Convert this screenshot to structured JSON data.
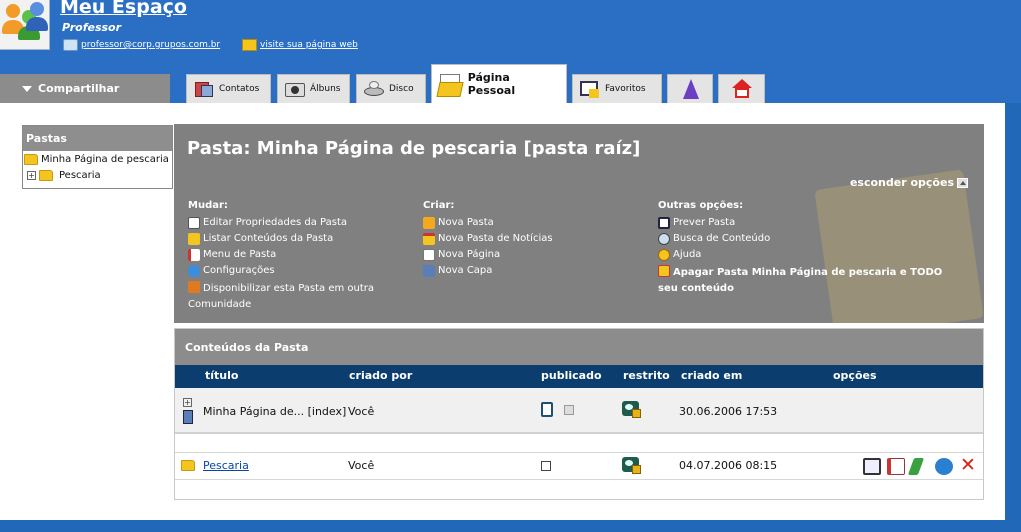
{
  "header": {
    "title": "Meu Espaço",
    "role": "Professor",
    "email": "professor@corp.grupos.com.br",
    "visit_link": "visite sua página web"
  },
  "tabs": {
    "share": "Compartilhar",
    "items": [
      {
        "label": "Contatos",
        "icon": "contacts-icon"
      },
      {
        "label": "Álbuns",
        "icon": "camera-icon"
      },
      {
        "label": "Disco",
        "icon": "disk-icon"
      },
      {
        "label": "Página Pessoal",
        "icon": "folder-page-icon",
        "active": true
      },
      {
        "label": "Favoritos",
        "icon": "favorites-icon"
      },
      {
        "label": "",
        "icon": "help-wizard-icon"
      },
      {
        "label": "",
        "icon": "home-icon"
      }
    ]
  },
  "sidebar": {
    "title": "Pastas",
    "root": "Minha Página de pescaria",
    "child": "Pescaria"
  },
  "panel": {
    "title": "Pasta: Minha Página de pescaria [pasta raíz]",
    "hide_options": "esconder opções",
    "mudar": {
      "heading": "Mudar:",
      "items": [
        "Editar Propriedades da Pasta",
        "Listar Conteúdos da Pasta",
        "Menu de Pasta",
        "Configurações",
        "Disponibilizar esta Pasta em outra Comunidade"
      ]
    },
    "criar": {
      "heading": "Criar:",
      "items": [
        "Nova Pasta",
        "Nova Pasta de Notícias",
        "Nova Página",
        "Nova Capa"
      ]
    },
    "outras": {
      "heading": "Outras opções:",
      "items": [
        "Prever Pasta",
        "Busca de Conteúdo",
        "Ajuda"
      ],
      "delete": "Apagar Pasta Minha Página de pescaria e TODO seu conteúdo"
    }
  },
  "table": {
    "title": "Conteúdos da Pasta",
    "columns": [
      "título",
      "criado por",
      "publicado",
      "restrito",
      "criado em",
      "opções"
    ],
    "rows": [
      {
        "title": "Minha Página de... [index]",
        "author": "Você",
        "published": true,
        "date": "30.06.2006 17:53"
      },
      {
        "title": "Pescaria",
        "author": "Você",
        "published": false,
        "date": "04.07.2006 08:15"
      }
    ]
  }
}
